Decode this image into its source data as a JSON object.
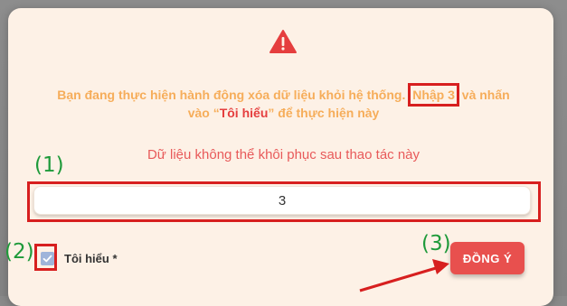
{
  "dialog": {
    "warning_line1_prefix": "Bạn đang thực hiện hành động xóa dữ liệu khỏi hệ thống. ",
    "warning_line1_code": "Nhập 3",
    "warning_line1_suffix": " và nhấn",
    "warning_line2_prefix": "vào “",
    "warning_line2_emph": "Tôi hiểu",
    "warning_line2_suffix": "” để thực hiện này",
    "irreversible_note": "Dữ liệu không thể khôi phục sau thao tác này",
    "confirm_input_value": "3",
    "checkbox_label": "Tôi hiểu *",
    "checkbox_checked": true,
    "agree_button_label": "ĐỒNG Ý"
  },
  "annotations": {
    "step1": "(1)",
    "step2": "(2)",
    "step3": "(3)"
  },
  "icons": {
    "warning": "warning-triangle-icon",
    "checkbox": "checkmark-icon"
  },
  "colors": {
    "warning_text": "#f6ad5a",
    "emphasis": "#e53e3e",
    "primary_button": "#e8504e",
    "annotation_outline": "#d71f1f",
    "annotation_label": "#1e9a3a"
  }
}
